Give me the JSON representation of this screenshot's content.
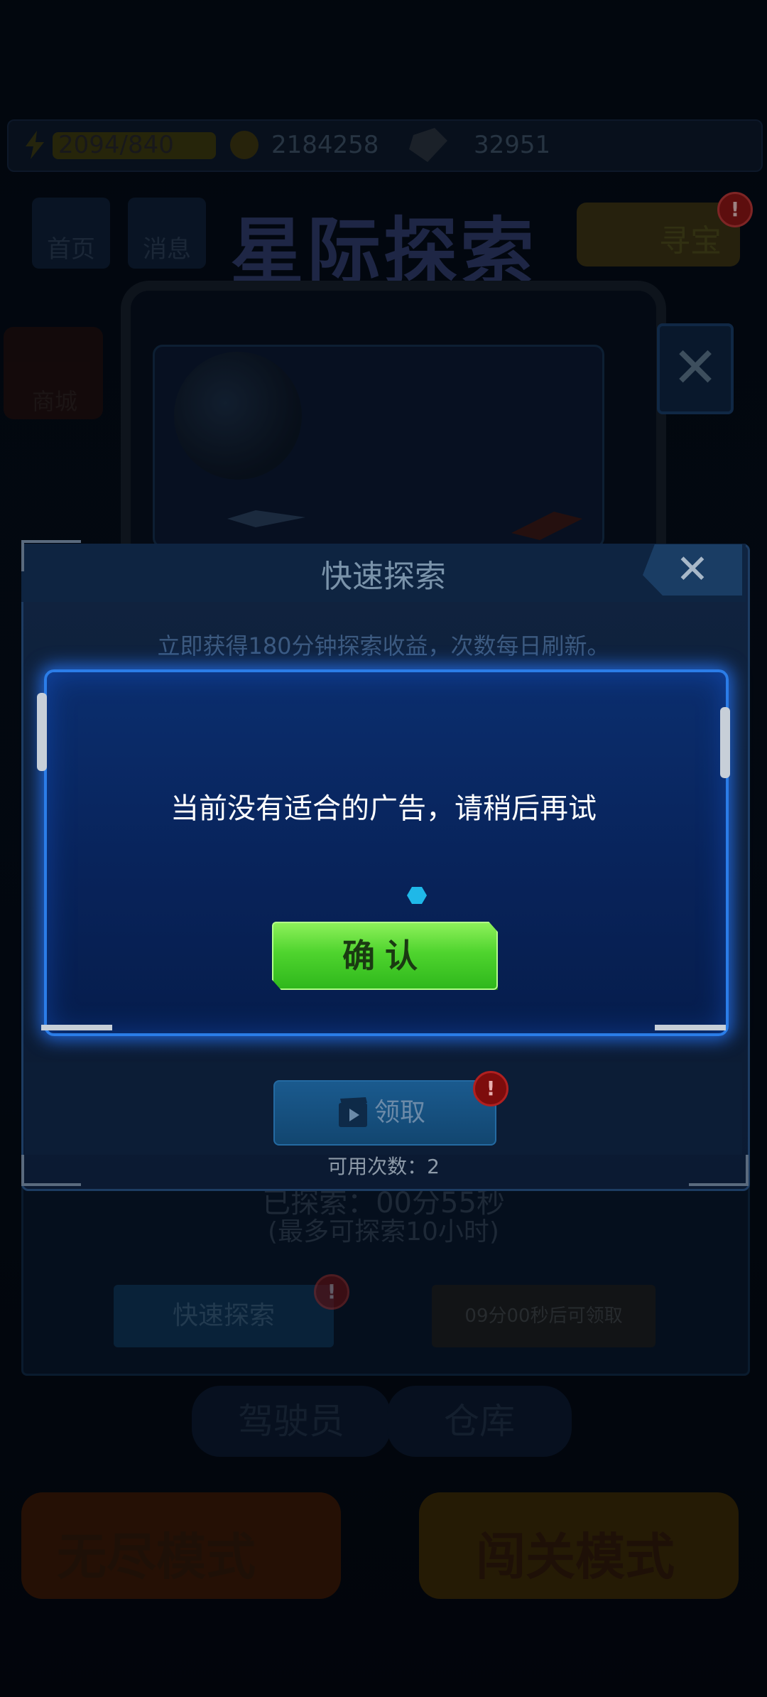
{
  "game": {
    "energy": "2094/840",
    "coins": "2184258",
    "gems": "32951",
    "tabs": [
      "首页",
      "消息"
    ],
    "title": "星际探索",
    "treasure_label": "寻宝",
    "side_labels": [
      "商城"
    ],
    "bottom_nav": [
      "驾驶员",
      "仓库"
    ],
    "modes": [
      "无尽模式",
      "闯关模式"
    ]
  },
  "explore_panel": {
    "explored_label": "已探索：",
    "explored_time": "00分55秒",
    "max_note": "(最多可探索10小时)",
    "quick_button": "快速探索",
    "wait_button": "09分00秒后可领取"
  },
  "quick_dialog": {
    "title": "快速探索",
    "close_glyph": "✕",
    "description": "立即获得180分钟探索收益，次数每日刷新。",
    "claim_button": "领取",
    "uses_label": "可用次数：",
    "uses_value": "2"
  },
  "ad_dialog": {
    "message": "当前没有适合的广告，请稍后再试",
    "confirm_button": "确认"
  },
  "alert_glyph": "!",
  "colors": {
    "accent_blue": "#2b7de8",
    "confirm_green": "#4fd42e",
    "alert_red": "#8f1616"
  }
}
